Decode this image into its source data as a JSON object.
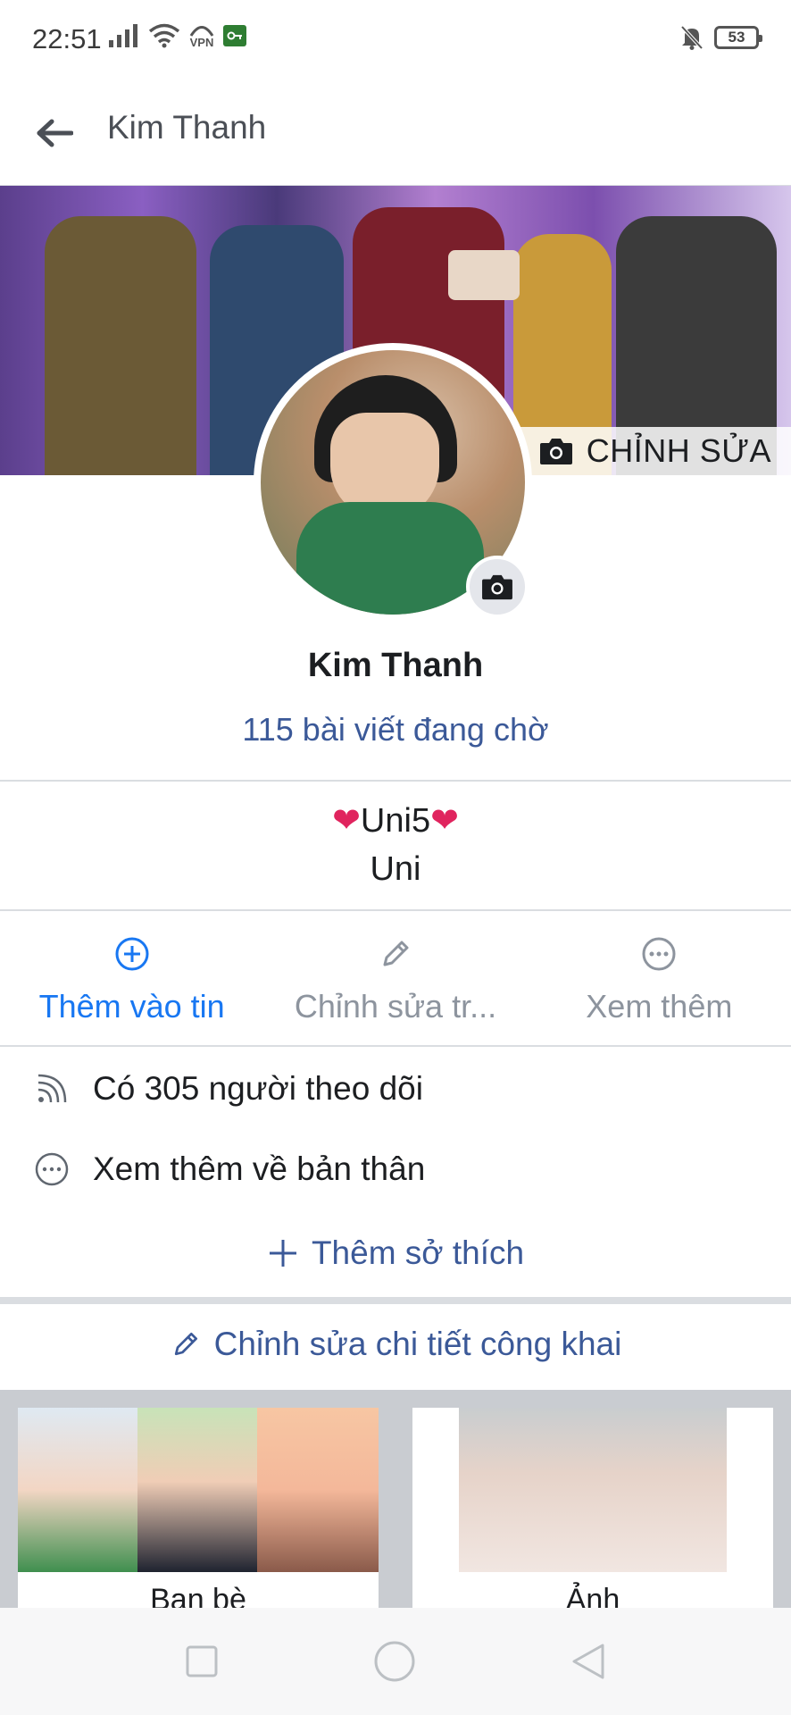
{
  "status_bar": {
    "time": "22:51",
    "vpn_label": "VPN",
    "battery": "53"
  },
  "header": {
    "title": "Kim Thanh"
  },
  "cover": {
    "edit_label": "CHỈNH SỬA"
  },
  "profile": {
    "name": "Kim Thanh",
    "pending_posts": "115 bài viết đang chờ"
  },
  "bio": {
    "line1_text": "Uni5",
    "heart": "❤",
    "line2": "Uni"
  },
  "actions": [
    {
      "label": "Thêm vào tin",
      "icon": "add-circle-icon"
    },
    {
      "label": "Chỉnh sửa tr...",
      "icon": "pencil-icon"
    },
    {
      "label": "Xem thêm",
      "icon": "more-dots-icon"
    }
  ],
  "info": {
    "followers": "Có 305 người theo dõi",
    "about": "Xem thêm về bản thân",
    "add_hobby": "Thêm sở thích"
  },
  "edit_public": "Chỉnh sửa chi tiết công khai",
  "cards": {
    "friends_label": "Bạn bè",
    "photos_label": "Ảnh"
  },
  "colors": {
    "link_blue": "#3b5998",
    "primary_blue": "#1877f2",
    "muted": "#8d949e"
  }
}
